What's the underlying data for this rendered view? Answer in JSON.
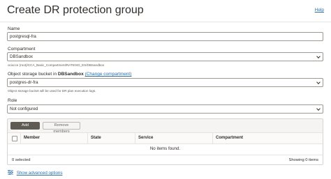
{
  "header": {
    "title": "Create DR protection group",
    "help_label": "Help"
  },
  "form": {
    "name": {
      "label": "Name",
      "value": "postgresql-fra"
    },
    "compartment": {
      "label": "Compartment",
      "value": "DBSandbox",
      "path": "ocixcce (root)/CCA_Basic_Compartment/RATEIXD_ES/DBSandbox"
    },
    "bucket": {
      "label_prefix": "Object storage bucket in ",
      "label_bold": "DBSandbox",
      "change_link": "(Change compartment)",
      "value": "postgres-dr-fra",
      "help": "Object storage bucket will be used for DR plan execution logs."
    },
    "role": {
      "label": "Role",
      "value": "Not configured"
    }
  },
  "members_table": {
    "add_button": "Add member",
    "remove_button": "Remove members",
    "columns": {
      "member": "Member",
      "state": "State",
      "service": "Service",
      "compartment": "Compartment"
    },
    "empty_text": "No items found.",
    "selected_text": "0 selected",
    "showing_text": "Showing 0 items"
  },
  "advanced": {
    "label": "Show advanced options",
    "icon": "sliders-icon"
  }
}
